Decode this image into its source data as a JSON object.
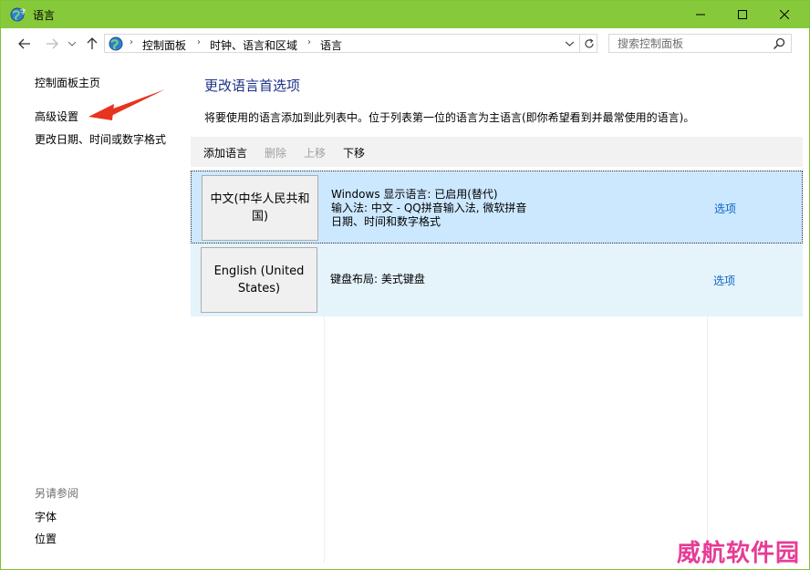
{
  "window": {
    "title": "语言",
    "colors": {
      "titlebar": "#86c93a",
      "link": "#0a64c2",
      "heading": "#1e3287"
    }
  },
  "address": {
    "breadcrumbs": [
      "控制面板",
      "时钟、语言和区域",
      "语言"
    ]
  },
  "search": {
    "placeholder": "搜索控制面板"
  },
  "left_nav": {
    "home": "控制面板主页",
    "advanced": "高级设置",
    "date_time": "更改日期、时间或数字格式",
    "see_also_title": "另请参阅",
    "fonts": "字体",
    "location": "位置"
  },
  "main": {
    "title": "更改语言首选项",
    "description": "将要使用的语言添加到此列表中。位于列表第一位的语言为主语言(即你希望看到并最常使用的语言)。",
    "toolbar": {
      "add": "添加语言",
      "remove": "删除",
      "move_up": "上移",
      "move_down": "下移"
    },
    "languages": [
      {
        "name": "中文(中华人民共和国)",
        "lines": [
          "Windows 显示语言: 已启用(替代)",
          "输入法: 中文 - QQ拼音输入法, 微软拼音",
          "日期、时间和数字格式"
        ],
        "options": "选项"
      },
      {
        "name": "English (United States)",
        "lines": [
          "键盘布局: 美式键盘"
        ],
        "options": "选项"
      }
    ]
  },
  "watermark": "威航软件园"
}
